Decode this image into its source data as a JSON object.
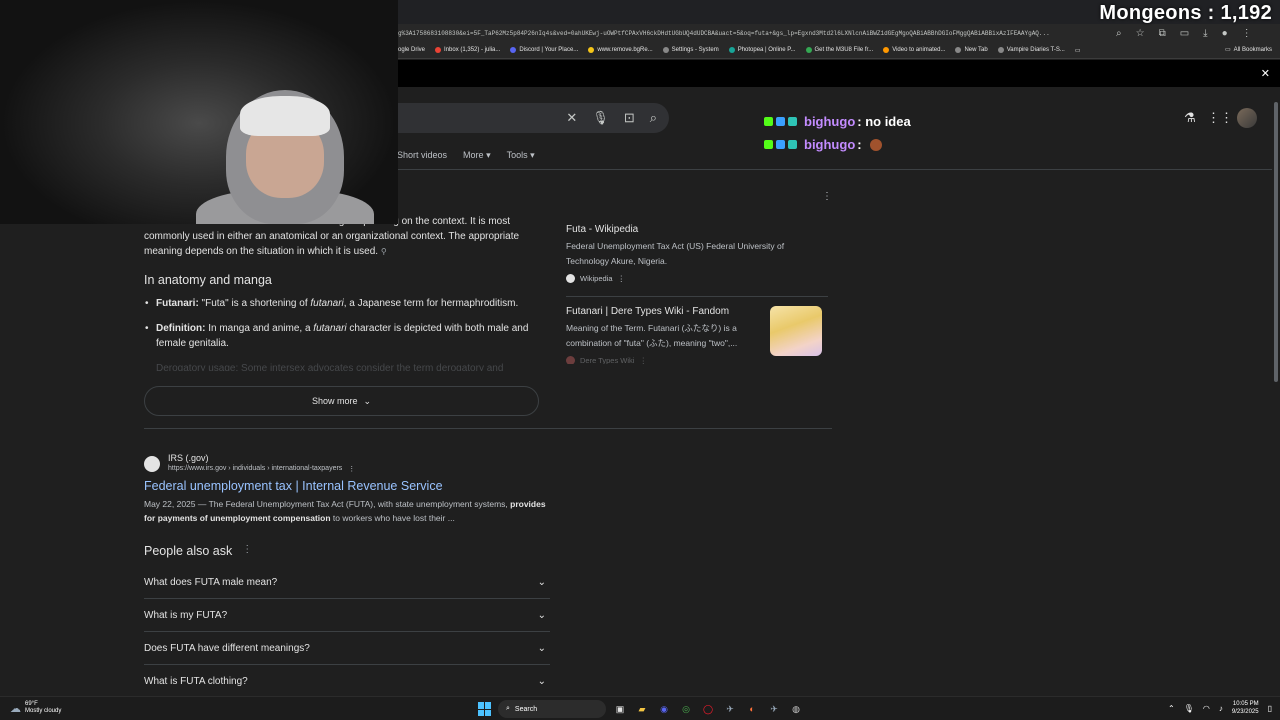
{
  "overlay": {
    "viewer_count": "Mongeons : 1,192",
    "chat": [
      {
        "user": "bighugo",
        "message": ": no idea"
      },
      {
        "user": "bighugo",
        "message": ":"
      }
    ]
  },
  "browser": {
    "url": "g%3A1758683108830&ei=5F_TaP62Mz5p84P26nIq4s&ved=0ahUKEwj-uOWPtfCPAxVH6ckDHdtUGbUQ4dUDCBA&uact=5&oq=futa+&gs_lp=Egxnd3Mtd2l6LXNlcnAiBWZ1dGEgMgoQABiABBhDGIoFMggQABiABBixAzIFEAAYgAQ...",
    "bookmarks": [
      "ogle Drive",
      "Inbox (1,352) - julia...",
      "Discord | Your Place...",
      "www.remove.bgRe...",
      "Settings - System",
      "Photopea | Online P...",
      "Get the M3U8 File fr...",
      "Video to animated...",
      "New Tab",
      "Vampire Diaries T-S..."
    ],
    "all_bookmarks": "All Bookmarks"
  },
  "search": {
    "tabs": [
      "Short videos",
      "More",
      "Tools"
    ]
  },
  "overview": {
    "lines": [
      "The term \"futa\" has several different meanings depending on the context. It is most",
      "commonly used in either an anatomical or an organizational context. The appropriate",
      "meaning depends on the situation in which it is used."
    ],
    "section_heading": "In anatomy and manga",
    "bullets": [
      {
        "label": "Futanari:",
        "text": " \"Futa\" is a shortening of ",
        "em": "futanari",
        "rest": ", a Japanese term for hermaphroditism."
      },
      {
        "label": "Definition:",
        "text": " In manga and anime, a ",
        "em": "futanari",
        "rest": " character is depicted with both male and female genitalia."
      }
    ],
    "faded_bullet": "Derogatory usage: Some intersex advocates consider the term derogatory and",
    "show_more": "Show more"
  },
  "sources": [
    {
      "title": "Futa - Wikipedia",
      "desc": "Federal Unemployment Tax Act (US) Federal University of Technology Akure, Nigeria.",
      "source": "Wikipedia"
    },
    {
      "title": "Futanari | Dere Types Wiki - Fandom",
      "desc": "Meaning of the Term. Futanari (ふたなり) is a combination of \"futa\" (ふた), meaning \"two\",...",
      "source": "Dere Types Wiki"
    }
  ],
  "result": {
    "site": "IRS (.gov)",
    "url": "https://www.irs.gov › individuals › international-taxpayers",
    "title": "Federal unemployment tax | Internal Revenue Service",
    "date": "May 22, 2025",
    "snippet_a": " — The Federal Unemployment Tax Act (FUTA), with state unemployment systems, ",
    "snippet_bold1": "provides",
    "snippet_bold2": "for payments of unemployment compensation",
    "snippet_b": " to workers who have lost their ..."
  },
  "people_also_ask": {
    "heading": "People also ask",
    "questions": [
      "What does FUTA male mean?",
      "What is my FUTA?",
      "Does FUTA have different meanings?",
      "What is FUTA clothing?"
    ]
  },
  "taskbar": {
    "temp": "69°F",
    "weather": "Mostly cloudy",
    "search": "Search",
    "time": "10:05 PM",
    "date": "9/23/2025"
  },
  "colors": {
    "link": "#99c3ff",
    "chat_user": "#c38cff",
    "page_bg": "#1f1f1f"
  }
}
